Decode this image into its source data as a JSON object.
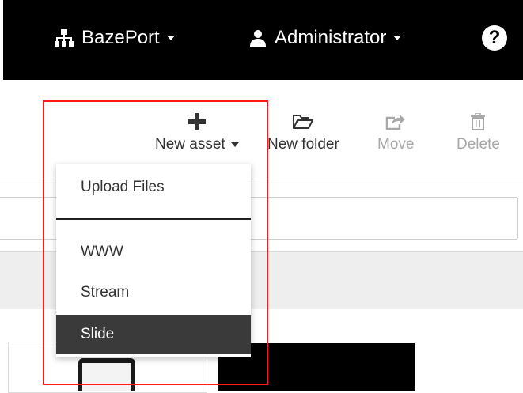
{
  "topbar": {
    "org_label": "BazePort",
    "user_label": "Administrator",
    "help_symbol": "?",
    "org_icon": "sitemap-icon",
    "user_icon": "user-icon"
  },
  "toolbar": {
    "new_asset_label": "New asset",
    "new_folder_label": "New folder",
    "move_label": "Move",
    "delete_label": "Delete"
  },
  "new_asset_menu": {
    "items": [
      "Upload Files",
      "WWW",
      "Stream",
      "Slide"
    ],
    "active_item": "Slide"
  },
  "colors": {
    "topbar_bg": "#000000",
    "highlight_border": "#ff1a1a",
    "menu_active_bg": "#3a3a3a",
    "disabled_text": "#a8a8a8"
  }
}
